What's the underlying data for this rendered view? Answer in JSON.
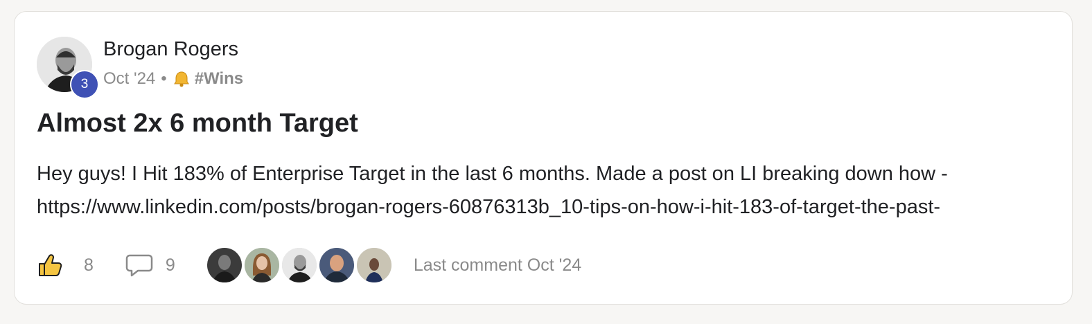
{
  "post": {
    "author": {
      "name": "Brogan Rogers",
      "level": "3"
    },
    "date": "Oct '24",
    "separator": "•",
    "category": "#Wins",
    "title": "Almost 2x 6 month Target",
    "body_lines": [
      "Hey guys! I Hit 183% of Enterprise Target in the last 6 months. Made a post on LI breaking down how -",
      "https://www.linkedin.com/posts/brogan-rogers-60876313b_10-tips-on-how-i-hit-183-of-target-the-past-"
    ],
    "likes": "8",
    "comments": "9",
    "last_comment": "Last comment Oct '24"
  },
  "icons": {
    "category": "bell-icon",
    "like": "thumbs-up-icon",
    "comment": "speech-bubble-icon"
  },
  "colors": {
    "level_badge": "#3f51b5",
    "like_icon_fill": "#f5c542"
  }
}
